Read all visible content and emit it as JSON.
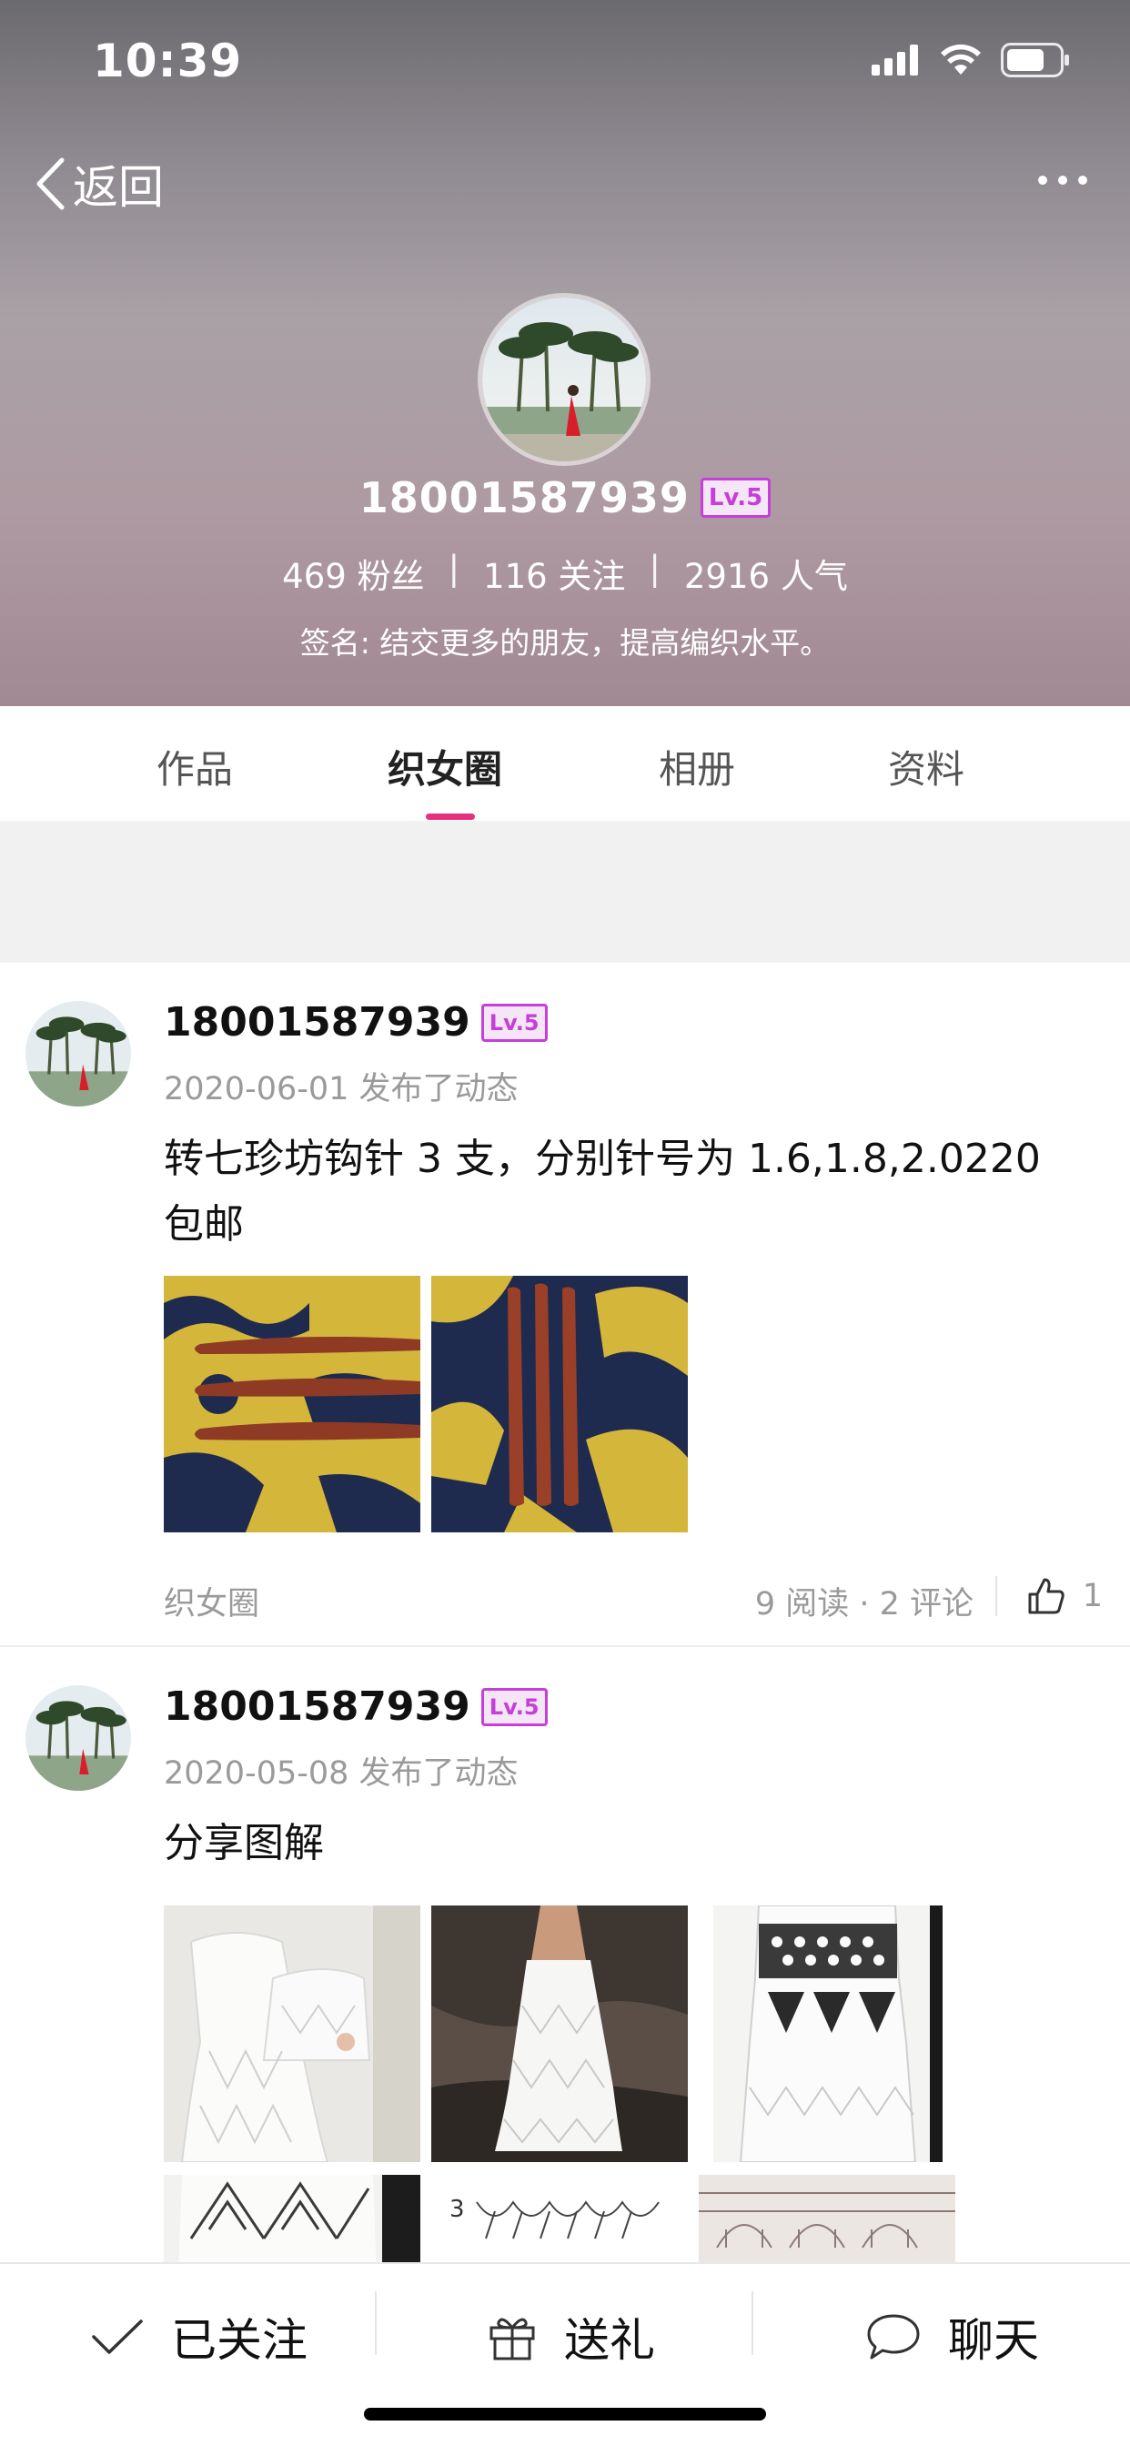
{
  "status_bar": {
    "time": "10:39"
  },
  "nav": {
    "back_label": "返回"
  },
  "profile": {
    "username": "18001587939",
    "level": "Lv.5",
    "followers": "469 粉丝",
    "following": "116 关注",
    "popularity": "2916 人气",
    "stat_separator": "|",
    "signature": "签名: 结交更多的朋友，提高编织水平。"
  },
  "tabs": [
    {
      "label": "作品"
    },
    {
      "label": "织女圈"
    },
    {
      "label": "相册"
    },
    {
      "label": "资料"
    }
  ],
  "active_tab": "织女圈",
  "posts": [
    {
      "username": "18001587939",
      "level": "Lv.5",
      "date": "2020-06-01 发布了动态",
      "text": "转七珍坊钩针 3 支，分别针号为 1.6,1.8,2.0220 包邮",
      "tag": "织女圈",
      "meta": "9 阅读 · 2 评论",
      "likes": "1"
    },
    {
      "username": "18001587939",
      "level": "Lv.5",
      "date": "2020-05-08 发布了动态",
      "text": "分享图解"
    }
  ],
  "bottom_bar": {
    "follow_label": "已关注",
    "gift_label": "送礼",
    "chat_label": "聊天"
  },
  "colors": {
    "accent": "#e6307d",
    "level_badge": "#c53fd8",
    "header_top": "#6b6a6e",
    "header_bottom": "#a28994"
  }
}
